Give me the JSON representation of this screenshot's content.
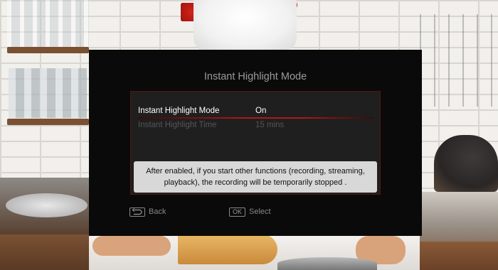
{
  "dialog": {
    "title": "Instant Highlight Mode",
    "settings": [
      {
        "label": "Instant Highlight Mode",
        "value": "On",
        "selected": true,
        "enabled": true
      },
      {
        "label": "Instant Highlight Time",
        "value": "15 mins",
        "selected": false,
        "enabled": false
      }
    ],
    "info_text": "After enabled, if you start other functions (recording, streaming, playback), the recording will be temporarily stopped ."
  },
  "footer": {
    "back": {
      "icon": "back-arrow-icon",
      "label": "Back"
    },
    "select": {
      "key": "OK",
      "label": "Select"
    }
  },
  "colors": {
    "dialog_bg": "#0a0a0a",
    "panel_bg": "#1f1f1f",
    "accent_red": "#b2171a",
    "info_bg": "#d8d8d8"
  }
}
